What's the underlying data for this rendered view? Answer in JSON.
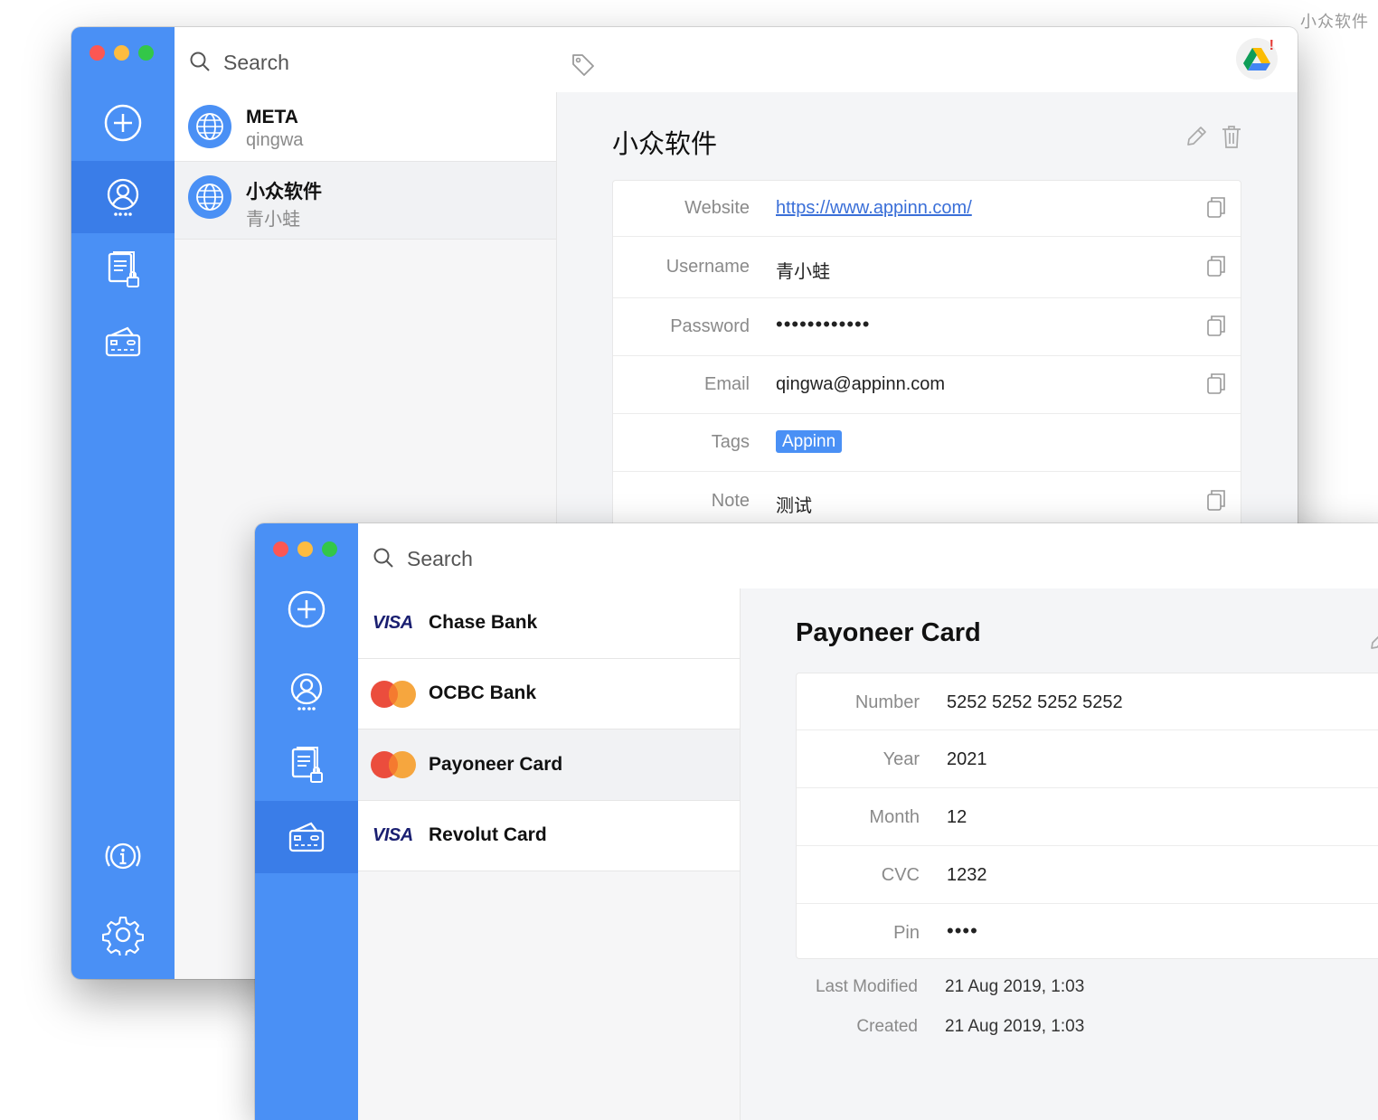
{
  "watermark": "小众软件",
  "window1": {
    "search_placeholder": "Search",
    "list": [
      {
        "title": "META",
        "subtitle": "qingwa"
      },
      {
        "title": "小众软件",
        "subtitle": "青小蛙"
      }
    ],
    "detail": {
      "title": "小众软件",
      "fields": [
        {
          "label": "Website",
          "value": "https://www.appinn.com/"
        },
        {
          "label": "Username",
          "value": "青小蛙"
        },
        {
          "label": "Password",
          "value": "••••••••••••"
        },
        {
          "label": "Email",
          "value": "qingwa@appinn.com"
        },
        {
          "label": "Tags",
          "value": "Appinn"
        },
        {
          "label": "Note",
          "value": "测试"
        }
      ]
    }
  },
  "window2": {
    "search_placeholder": "Search",
    "list": [
      {
        "title": "Chase Bank",
        "brand": "visa"
      },
      {
        "title": "OCBC Bank",
        "brand": "mastercard"
      },
      {
        "title": "Payoneer Card",
        "brand": "mastercard"
      },
      {
        "title": "Revolut Card",
        "brand": "visa"
      }
    ],
    "brand_labels": {
      "visa": "VISA"
    },
    "detail": {
      "title": "Payoneer Card",
      "fields": [
        {
          "label": "Number",
          "value": "5252 5252 5252 5252"
        },
        {
          "label": "Year",
          "value": "2021"
        },
        {
          "label": "Month",
          "value": "12"
        },
        {
          "label": "CVC",
          "value": "1232"
        },
        {
          "label": "Pin",
          "value": "••••"
        }
      ],
      "meta": [
        {
          "label": "Last Modified",
          "value": "21 Aug 2019, 1:03"
        },
        {
          "label": "Created",
          "value": "21 Aug 2019, 1:03"
        }
      ]
    }
  },
  "colors": {
    "sidebar": "#4a90f5",
    "sidebar_active": "#3a7de8",
    "accent": "#4a90f5"
  }
}
